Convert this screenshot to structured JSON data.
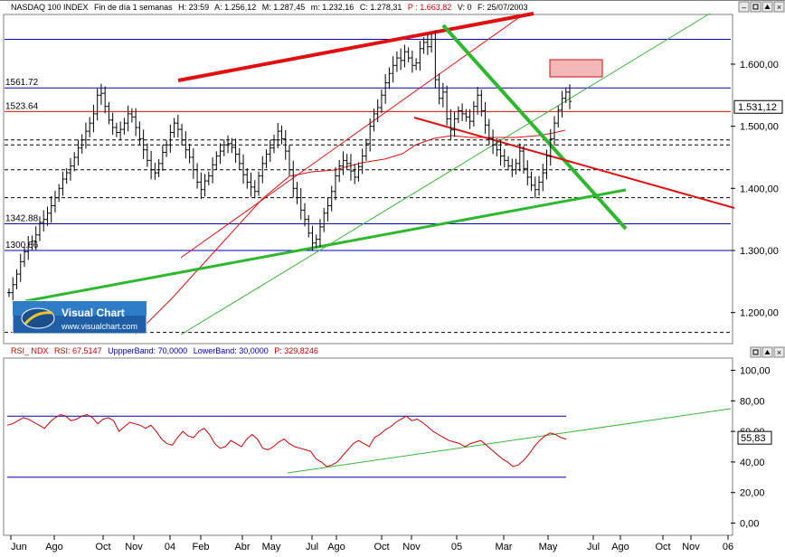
{
  "header": {
    "instrument": "NASDAQ 100 INDEX",
    "period": "Fin de día 1 semanas",
    "time": "H: 23:59",
    "open": "A: 1.256,12",
    "high": "M: 1.287,45",
    "low": "m: 1.232,16",
    "close": "C: 1.278,31",
    "p": "P : 1.663,82",
    "volume": "V: 0",
    "date": "F: 25/07/2003"
  },
  "rsi_header": {
    "name": "RSI_ NDX",
    "value": "RSI: 67,5147",
    "upper": "UppperBand: 70,0000",
    "lower": "LowerBand: 30,0000",
    "p": "P: 329,8246"
  },
  "logo": {
    "title": "Visual Chart",
    "url": "www.visualchart.com"
  },
  "colors": {
    "up_line": "#e01010",
    "support": "#2db82d",
    "level": "#0000c0",
    "price": "#000000",
    "rsi": "#cc0000",
    "box_fill": "#f5b8b8"
  },
  "chart_data": [
    {
      "type": "line",
      "subtype": "ohlc-bars",
      "title": "NASDAQ 100 INDEX",
      "ylim": [
        1150,
        1680
      ],
      "y_ticks": [
        "1.200,00",
        "1.300,00",
        "1.400,00",
        "1.500,00",
        "1.600,00"
      ],
      "y_tick_values": [
        1200,
        1300,
        1400,
        1500,
        1600
      ],
      "current_value": 1531.12,
      "current_label": "1.531,12",
      "levels": [
        {
          "value": 1640,
          "label": "",
          "color": "#0000c0"
        },
        {
          "value": 1561.72,
          "label": "1561.72",
          "color": "#0000c0"
        },
        {
          "value": 1523.64,
          "label": "1523.64",
          "color": "#e01010"
        },
        {
          "value": 1342.88,
          "label": "1342.88",
          "color": "#0000c0"
        },
        {
          "value": 1300.06,
          "label": "1300.06",
          "color": "#0000c0"
        }
      ],
      "dashed_levels": [
        1478,
        1470,
        1430,
        1385,
        1168
      ],
      "close_series": [
        1232,
        1245,
        1262,
        1282,
        1298,
        1310,
        1315,
        1325,
        1345,
        1350,
        1360,
        1372,
        1385,
        1400,
        1415,
        1425,
        1436,
        1450,
        1465,
        1478,
        1492,
        1505,
        1520,
        1550,
        1553,
        1532,
        1510,
        1498,
        1490,
        1495,
        1505,
        1520,
        1515,
        1498,
        1480,
        1462,
        1445,
        1430,
        1425,
        1440,
        1458,
        1470,
        1490,
        1505,
        1495,
        1478,
        1462,
        1450,
        1430,
        1410,
        1398,
        1412,
        1420,
        1438,
        1452,
        1460,
        1470,
        1472,
        1466,
        1455,
        1440,
        1422,
        1410,
        1402,
        1395,
        1420,
        1440,
        1455,
        1465,
        1478,
        1492,
        1480,
        1460,
        1430,
        1400,
        1385,
        1365,
        1350,
        1328,
        1312,
        1318,
        1338,
        1360,
        1372,
        1395,
        1420,
        1436,
        1445,
        1440,
        1428,
        1418,
        1435,
        1452,
        1472,
        1500,
        1520,
        1530,
        1550,
        1570,
        1585,
        1598,
        1610,
        1606,
        1620,
        1610,
        1598,
        1602,
        1625,
        1635,
        1628,
        1640,
        1575,
        1545,
        1555,
        1512,
        1494,
        1512,
        1525,
        1520,
        1515,
        1508,
        1532,
        1550,
        1525,
        1502,
        1480,
        1470,
        1462,
        1452,
        1445,
        1436,
        1430,
        1440,
        1460,
        1432,
        1418,
        1405,
        1398,
        1410,
        1425,
        1452,
        1480,
        1505,
        1526,
        1545,
        1555,
        1540
      ],
      "x_months": [
        "Jun",
        "Ago",
        "Oct",
        "Nov",
        "04",
        "Feb",
        "Abr",
        "May",
        "Jul",
        "Ago",
        "Oct",
        "Nov",
        "05",
        "Mar",
        "May",
        "Jul",
        "Ago",
        "Oct",
        "Nov",
        "06"
      ]
    },
    {
      "type": "line",
      "title": "RSI_ NDX",
      "ylim": [
        -8,
        108
      ],
      "y_ticks": [
        "0,00",
        "20,00",
        "40,00",
        "60,00",
        "80,00",
        "100,00"
      ],
      "y_tick_values": [
        0,
        20,
        40,
        60,
        80,
        100
      ],
      "upper_band": 70,
      "lower_band": 30,
      "current_value": 55.83,
      "current_label": "55,83",
      "series": [
        {
          "values": [
            64,
            65,
            67,
            69,
            68,
            66,
            64,
            62,
            66,
            69,
            71,
            70,
            67,
            68,
            70,
            71,
            69,
            65,
            68,
            69,
            67,
            60,
            63,
            66,
            65,
            64,
            62,
            64,
            60,
            55,
            52,
            51,
            56,
            60,
            57,
            56,
            60,
            62,
            58,
            52,
            49,
            50,
            54,
            52,
            50,
            55,
            58,
            55,
            49,
            48,
            50,
            53,
            55,
            52,
            50,
            49,
            48,
            47,
            42,
            40,
            37,
            38,
            40,
            44,
            48,
            52,
            54,
            52,
            50,
            56,
            58,
            61,
            63,
            66,
            68,
            70,
            67,
            68,
            66,
            63,
            60,
            58,
            56,
            54,
            53,
            52,
            50,
            52,
            53,
            54,
            51,
            48,
            45,
            42,
            40,
            37,
            38,
            41,
            45,
            50,
            54,
            57,
            59,
            58,
            56,
            55
          ]
        }
      ]
    }
  ]
}
